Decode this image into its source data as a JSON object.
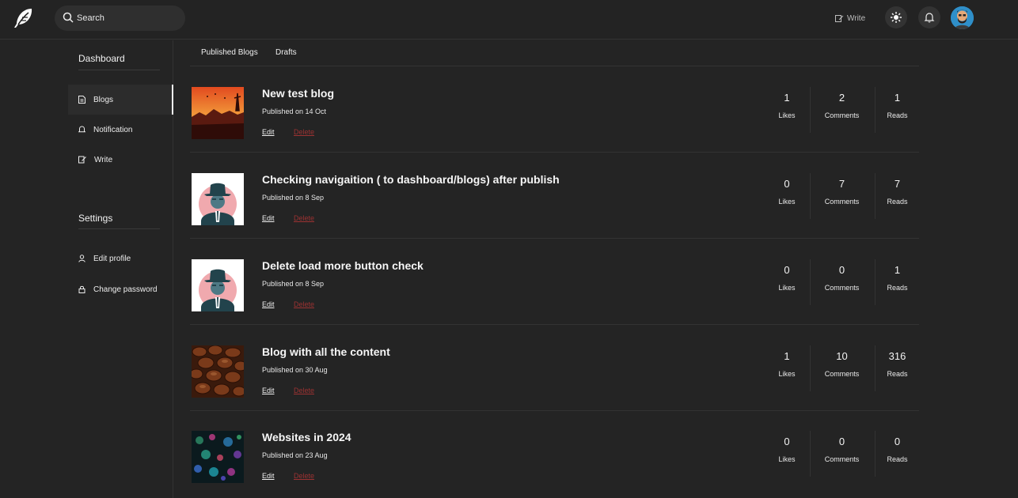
{
  "header": {
    "search_placeholder": "Search",
    "write_label": "Write",
    "logo_icon": "feather-logo",
    "theme_icon": "sun-icon",
    "bell_icon": "bell-icon"
  },
  "sidebar": {
    "dashboard_heading": "Dashboard",
    "dashboard_items": [
      {
        "label": "Blogs",
        "icon": "document-icon",
        "active": true
      },
      {
        "label": "Notification",
        "icon": "bell-icon",
        "active": false
      },
      {
        "label": "Write",
        "icon": "write-icon",
        "active": false
      }
    ],
    "settings_heading": "Settings",
    "settings_items": [
      {
        "label": "Edit profile",
        "icon": "user-icon"
      },
      {
        "label": "Change password",
        "icon": "lock-icon"
      }
    ]
  },
  "tabs": [
    "Published Blogs",
    "Drafts"
  ],
  "blogs": [
    {
      "title": "New test blog",
      "date": "Published on 14 Oct",
      "edit": "Edit",
      "delete": "Delete",
      "likes": "1",
      "comments": "2",
      "reads": "1",
      "thumb": "sunset"
    },
    {
      "title": "Checking navigaition ( to dashboard/blogs) after publish",
      "date": "Published on 8 Sep",
      "edit": "Edit",
      "delete": "Delete",
      "likes": "0",
      "comments": "7",
      "reads": "7",
      "thumb": "hat-man"
    },
    {
      "title": "Delete load more button check",
      "date": "Published on 8 Sep",
      "edit": "Edit",
      "delete": "Delete",
      "likes": "0",
      "comments": "0",
      "reads": "1",
      "thumb": "hat-man"
    },
    {
      "title": "Blog with all the content",
      "date": "Published on 30 Aug",
      "edit": "Edit",
      "delete": "Delete",
      "likes": "1",
      "comments": "10",
      "reads": "316",
      "thumb": "coffee"
    },
    {
      "title": "Websites in 2024",
      "date": "Published on 23 Aug",
      "edit": "Edit",
      "delete": "Delete",
      "likes": "0",
      "comments": "0",
      "reads": "0",
      "thumb": "bokeh"
    }
  ],
  "stat_labels": {
    "likes": "Likes",
    "comments": "Comments",
    "reads": "Reads"
  },
  "colors": {
    "background": "#242424",
    "delete": "#9c3232",
    "divider": "#333333"
  }
}
